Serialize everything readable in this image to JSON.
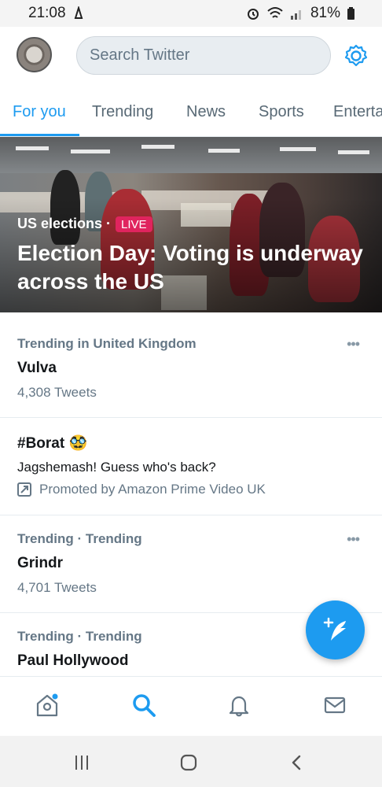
{
  "status_bar": {
    "time": "21:08",
    "battery": "81%"
  },
  "header": {
    "search_placeholder": "Search Twitter"
  },
  "tabs": [
    {
      "label": "For you",
      "active": true
    },
    {
      "label": "Trending",
      "active": false
    },
    {
      "label": "News",
      "active": false
    },
    {
      "label": "Sports",
      "active": false
    },
    {
      "label": "Enterta",
      "active": false
    }
  ],
  "hero": {
    "topic": "US elections ·",
    "live_badge": "LIVE",
    "title": "Election Day: Voting is underway across the US"
  },
  "trends": [
    {
      "meta": "Trending in United Kingdom",
      "name": "Vulva",
      "count": "4,308 Tweets"
    },
    {
      "meta": "Trending · Trending",
      "name": "Grindr",
      "count": "4,701 Tweets"
    },
    {
      "meta": "Trending · Trending",
      "name": "Paul Hollywood"
    }
  ],
  "promoted": {
    "name": "#Borat 🥸",
    "description": "Jagshemash! Guess who's back?",
    "promoted_by": "Promoted by Amazon Prime Video UK"
  },
  "more_icon_text": "•••",
  "icons": {
    "avatar": "profile-avatar",
    "settings": "gear-icon",
    "compose": "quill-plus-icon",
    "home": "home-icon",
    "search": "search-icon",
    "notifications": "bell-icon",
    "messages": "mail-icon"
  },
  "colors": {
    "accent": "#1d9bf0",
    "live": "#e0245e",
    "text_secondary": "#657786"
  }
}
